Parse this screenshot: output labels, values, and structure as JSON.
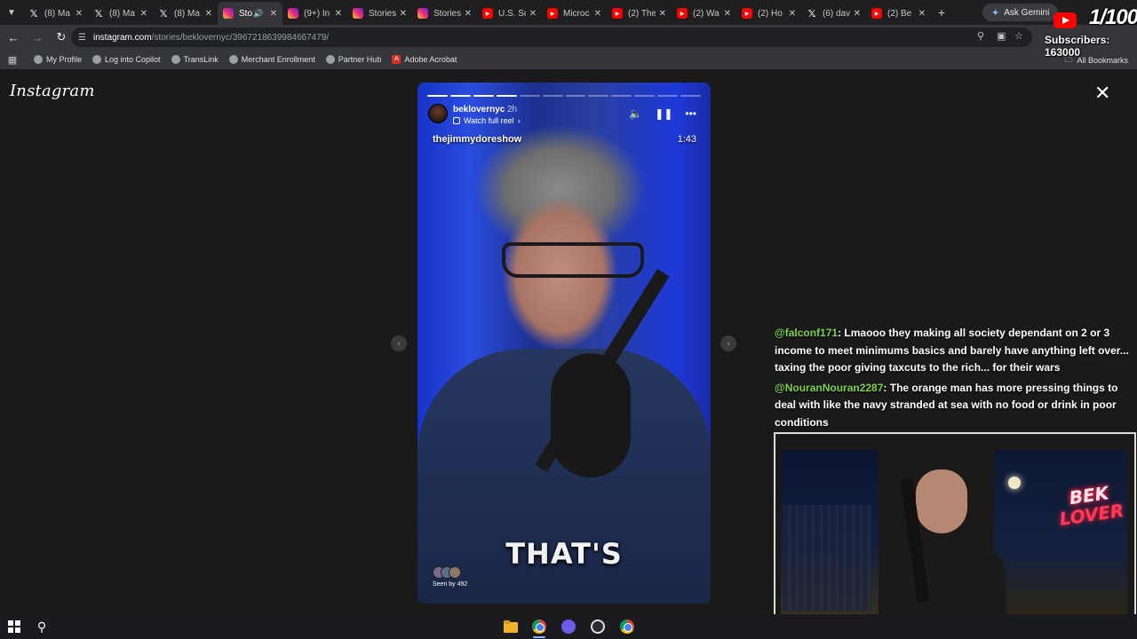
{
  "browser": {
    "tabs": [
      {
        "icon": "x-icon",
        "title": "(8) Ma",
        "active": false
      },
      {
        "icon": "x-icon",
        "title": "(8) Ma",
        "active": false
      },
      {
        "icon": "x-icon",
        "title": "(8) Ma",
        "active": false
      },
      {
        "icon": "instagram-icon",
        "title": "Sto",
        "active": true
      },
      {
        "icon": "instagram-icon",
        "title": "(9+) In",
        "active": false
      },
      {
        "icon": "instagram-icon",
        "title": "Stories",
        "active": false
      },
      {
        "icon": "instagram-icon",
        "title": "Stories",
        "active": false
      },
      {
        "icon": "youtube-icon",
        "title": "U.S. Sc",
        "active": false
      },
      {
        "icon": "youtube-icon",
        "title": "Microc",
        "active": false
      },
      {
        "icon": "youtube-icon",
        "title": "(2) The",
        "active": false
      },
      {
        "icon": "youtube-icon",
        "title": "(2) Wa",
        "active": false
      },
      {
        "icon": "youtube-icon",
        "title": "(2) Ho",
        "active": false
      },
      {
        "icon": "x-icon",
        "title": "(6) dav",
        "active": false
      },
      {
        "icon": "youtube-icon",
        "title": "(2) Be",
        "active": false
      }
    ],
    "gemini_label": "Ask Gemini",
    "url_host": "instagram.com",
    "url_path": "/stories/beklovernyc/3967218639984667479/",
    "bookmarks": [
      {
        "icon": "profile-icon",
        "label": "My Profile"
      },
      {
        "icon": "copilot-icon",
        "label": "Log into Copilot"
      },
      {
        "icon": "translink-icon",
        "label": "TransLink"
      },
      {
        "icon": "merchant-icon",
        "label": "Merchant Enrollment"
      },
      {
        "icon": "partner-icon",
        "label": "Partner Hub"
      },
      {
        "icon": "acrobat-icon",
        "label": "Adobe Acrobat"
      }
    ],
    "all_bookmarks_label": "All Bookmarks"
  },
  "instagram": {
    "logo": "Instagram",
    "story": {
      "username": "beklovernyc",
      "time_ago": "2h",
      "watch_full_reel": "Watch full reel",
      "overlay_handle": "thejimmydoreshow",
      "video_time": "1:43",
      "caption": "THAT'S",
      "seen_by": "Seen by 492",
      "progress_total": 12,
      "progress_done": 4
    }
  },
  "chat": {
    "messages": [
      {
        "handle": "@falconf171",
        "text": ": Lmaooo they making all society dependant on 2 or 3 income to meet minimums basics and barely have anything left over... taxing the poor giving taxcuts to the rich... for their wars"
      },
      {
        "handle": "@NouranNouran2287",
        "text": ": The orange man has more pressing things to deal with like the navy stranded at sea with no food or drink in poor conditions"
      }
    ]
  },
  "stream_overlay": {
    "subscriber_goal": "1/100",
    "subscribers_label": "Subscribers: 163000",
    "neon_line1": "BEK",
    "neon_line2": "LOVER"
  },
  "colors": {
    "chat_handle": "#7fd34c",
    "instagram_bg": "#1a1a1a",
    "youtube_red": "#ff0000"
  }
}
